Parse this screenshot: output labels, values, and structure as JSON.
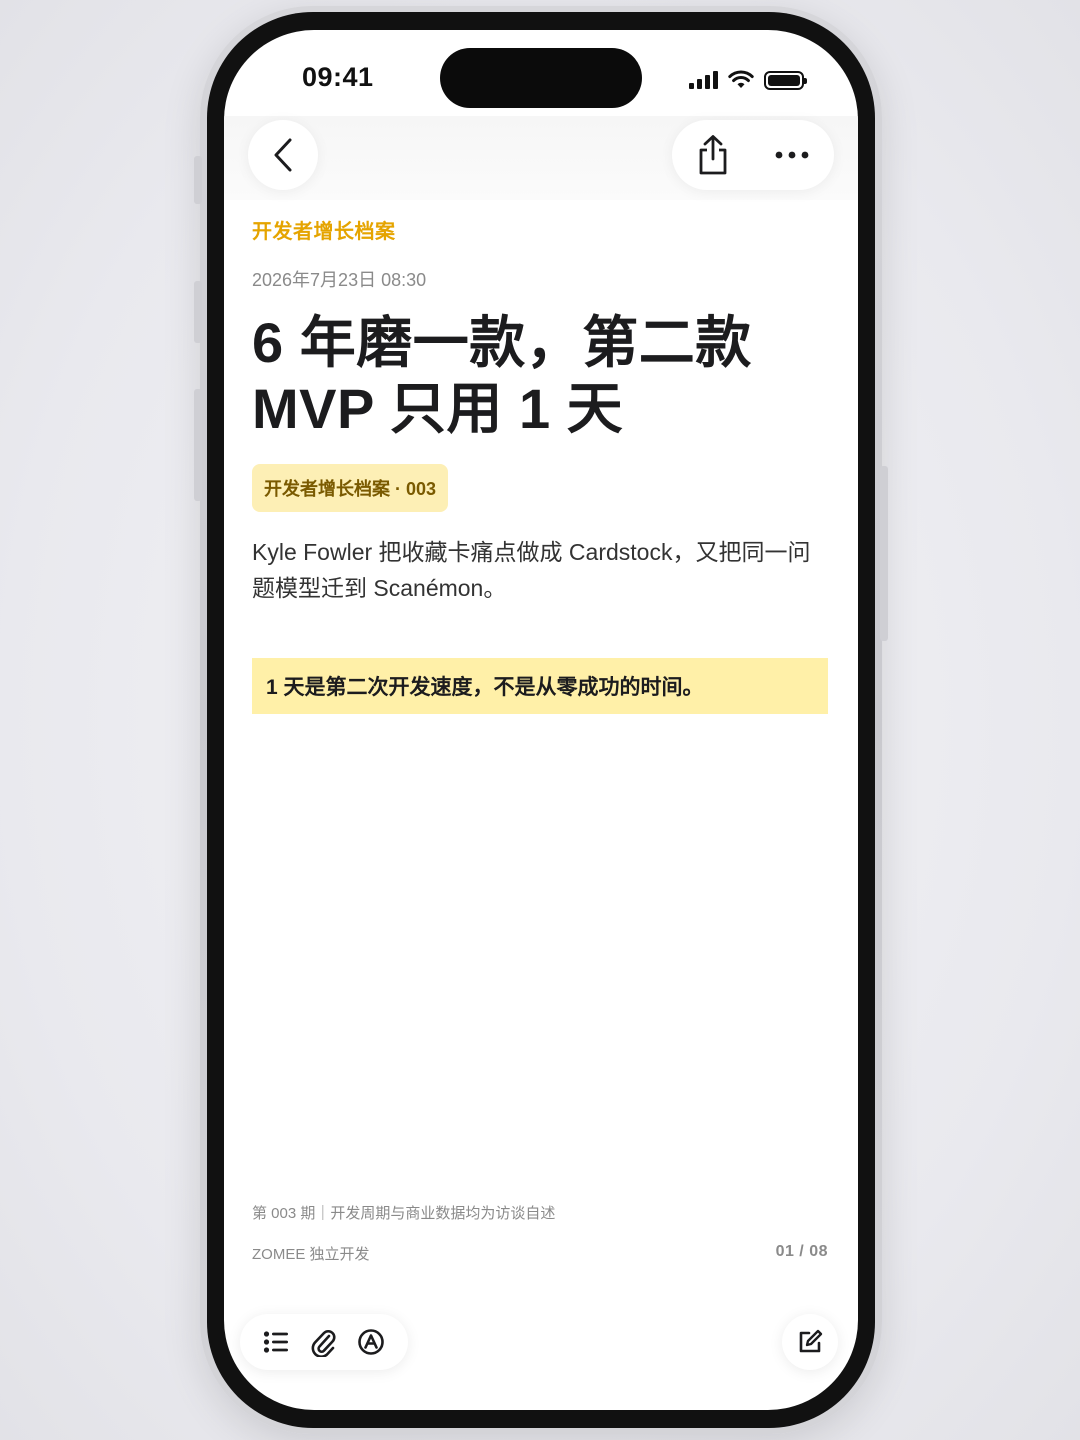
{
  "status_bar": {
    "time": "09:41"
  },
  "note": {
    "folder": "开发者增长档案",
    "date": "2026年7月23日 08:30",
    "title_line1": "6 年磨一款，第二款",
    "title_line2": "MVP 只用 1 天",
    "tag": "开发者增长档案 · 003",
    "summary": "Kyle Fowler 把收藏卡痛点做成 Cardstock，又把同一问题模型迁到 Scanémon。",
    "highlight": "1 天是第二次开发速度，不是从零成功的时间。",
    "footer_note": "第 003 期｜开发周期与商业数据均为访谈自述",
    "brand": "ZOMEE 独立开发",
    "page_indicator": "01 / 08"
  },
  "colors": {
    "accent": "#e5a400",
    "tag_bg": "#fdefb5",
    "highlight_bg": "#fff0a8"
  },
  "icons": {
    "back": "chevron-left-icon",
    "share": "share-icon",
    "more": "ellipsis-icon",
    "checklist": "checklist-icon",
    "attach": "paperclip-icon",
    "markup": "markup-icon",
    "compose": "compose-icon"
  }
}
